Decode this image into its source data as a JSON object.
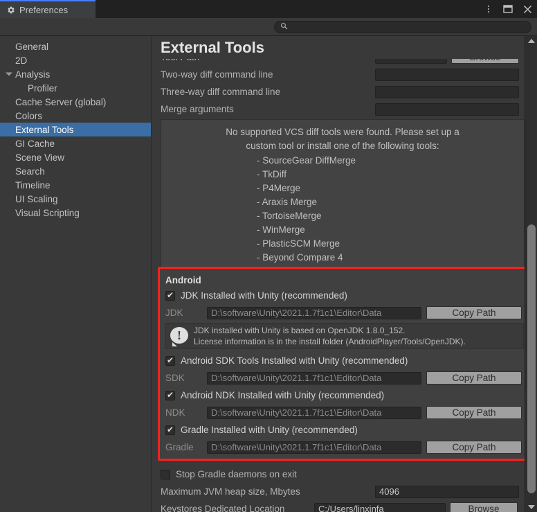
{
  "titlebar": {
    "tab_label": "Preferences",
    "gear_icon": "gear-icon",
    "kebab_icon": "kebab-menu-icon",
    "maximize_icon": "maximize-icon",
    "close_icon": "close-icon",
    "close_glyph": "✕"
  },
  "search": {
    "placeholder": "",
    "value": "",
    "icon": "search-icon",
    "glyph": "🔍"
  },
  "sidebar": {
    "items": [
      {
        "label": "General",
        "selected": false,
        "child": false,
        "expander": false
      },
      {
        "label": "2D",
        "selected": false,
        "child": false,
        "expander": false
      },
      {
        "label": "Analysis",
        "selected": false,
        "child": false,
        "expander": true
      },
      {
        "label": "Profiler",
        "selected": false,
        "child": true,
        "expander": false
      },
      {
        "label": "Cache Server (global)",
        "selected": false,
        "child": false,
        "expander": false
      },
      {
        "label": "Colors",
        "selected": false,
        "child": false,
        "expander": false
      },
      {
        "label": "External Tools",
        "selected": true,
        "child": false,
        "expander": false
      },
      {
        "label": "GI Cache",
        "selected": false,
        "child": false,
        "expander": false
      },
      {
        "label": "Scene View",
        "selected": false,
        "child": false,
        "expander": false
      },
      {
        "label": "Search",
        "selected": false,
        "child": false,
        "expander": false
      },
      {
        "label": "Timeline",
        "selected": false,
        "child": false,
        "expander": false
      },
      {
        "label": "UI Scaling",
        "selected": false,
        "child": false,
        "expander": false
      },
      {
        "label": "Visual Scripting",
        "selected": false,
        "child": false,
        "expander": false
      }
    ]
  },
  "page": {
    "title": "External Tools"
  },
  "vcs_rows": {
    "tool_path": {
      "label": "Tool Path",
      "value": "",
      "browse_label": "Browse"
    },
    "two_way": {
      "label": "Two-way diff command line",
      "value": ""
    },
    "three_way": {
      "label": "Three-way diff command line",
      "value": ""
    },
    "merge_args": {
      "label": "Merge arguments",
      "value": ""
    }
  },
  "vcs_help": {
    "line1": "No supported VCS diff tools were found. Please set up a",
    "line2": "custom tool or install one of the following tools:",
    "tools": [
      "- SourceGear DiffMerge",
      "- TkDiff",
      "- P4Merge",
      "- Araxis Merge",
      "- TortoiseMerge",
      "- WinMerge",
      "- PlasticSCM Merge",
      "- Beyond Compare 4"
    ]
  },
  "android": {
    "section_title": "Android",
    "highlight_color": "#ff1f1f",
    "jdk": {
      "checkbox_label": "JDK Installed with Unity (recommended)",
      "checked": true,
      "path_label": "JDK",
      "path_value": "D:\\software\\Unity\\2021.1.7f1c1\\Editor\\Data",
      "copy_label": "Copy Path"
    },
    "jdk_note": {
      "icon": "exclamation-icon",
      "glyph": "!",
      "line1": "JDK installed with Unity is based on OpenJDK 1.8.0_152.",
      "line2": "License information is in the install folder (AndroidPlayer/Tools/OpenJDK)."
    },
    "sdk": {
      "checkbox_label": "Android SDK Tools Installed with Unity (recommended)",
      "checked": true,
      "path_label": "SDK",
      "path_value": "D:\\software\\Unity\\2021.1.7f1c1\\Editor\\Data",
      "copy_label": "Copy Path"
    },
    "ndk": {
      "checkbox_label": "Android NDK Installed with Unity (recommended)",
      "checked": true,
      "path_label": "NDK",
      "path_value": "D:\\software\\Unity\\2021.1.7f1c1\\Editor\\Data",
      "copy_label": "Copy Path"
    },
    "gradle": {
      "checkbox_label": "Gradle Installed with Unity (recommended)",
      "checked": true,
      "path_label": "Gradle",
      "path_value": "D:\\software\\Unity\\2021.1.7f1c1\\Editor\\Data",
      "copy_label": "Copy Path"
    }
  },
  "bottom": {
    "stop_gradle": {
      "label": "Stop Gradle daemons on exit",
      "checked": false
    },
    "jvm_heap": {
      "label": "Maximum JVM heap size, Mbytes",
      "value": "4096"
    },
    "keystores": {
      "label": "Keystores Dedicated Location",
      "value": "C:/Users/linxinfa",
      "browse_label": "Browse"
    }
  },
  "scrollbar": {
    "up_icon": "scroll-up-arrow-icon",
    "down_icon": "scroll-down-arrow-icon",
    "thumb": "scroll-thumb"
  }
}
